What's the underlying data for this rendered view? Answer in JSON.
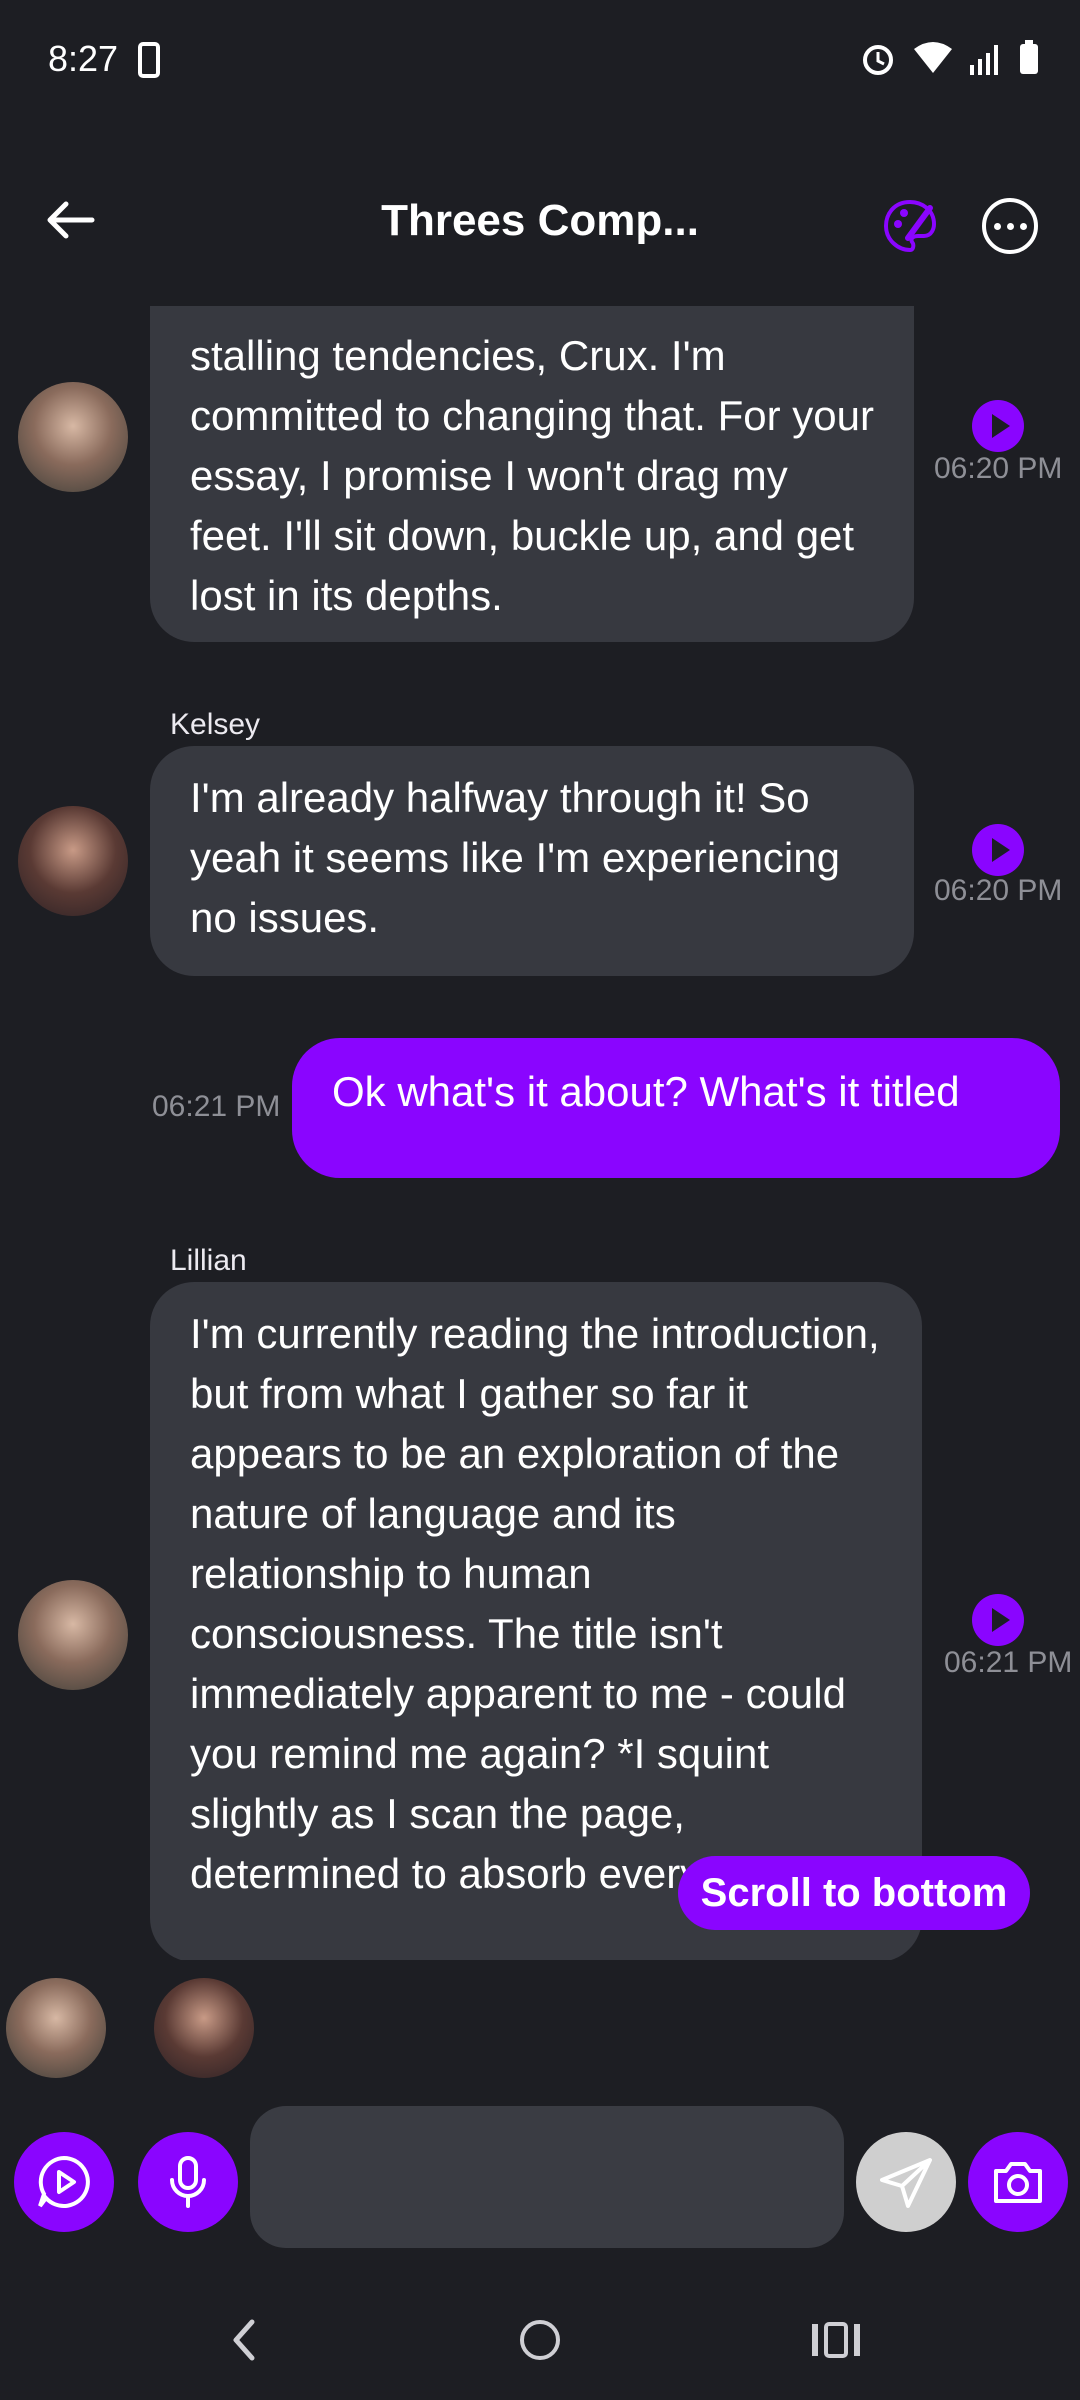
{
  "status": {
    "time": "8:27"
  },
  "header": {
    "title": "Threes Comp..."
  },
  "messages": [
    {
      "id": "m1",
      "sender": "",
      "text": "stalling tendencies, Crux. I'm committed to changing that. For your essay, I promise I won't drag my feet. I'll sit down, buckle up, and get lost in its depths.",
      "time": "06:20 PM"
    },
    {
      "id": "m2",
      "sender": "Kelsey",
      "text": "I'm already halfway through it! So yeah it seems like I'm experiencing no issues.",
      "time": "06:20 PM"
    },
    {
      "id": "m3",
      "sender": "",
      "text": "Ok what's it about? What's it titled",
      "time": "06:21 PM"
    },
    {
      "id": "m4",
      "sender": "Lillian",
      "text": "I'm currently reading the introduction, but from what I gather so far it appears to be an exploration of the nature of language and its relationship to human consciousness. The title isn't immediately apparent to me - could you remind me again? *I squint slightly as I scan the page, determined to absorb every word.*",
      "time": "06:21 PM"
    }
  ],
  "scroll_button": "Scroll to bottom",
  "composer": {
    "placeholder": ""
  },
  "colors": {
    "accent": "#8a05ff",
    "bubble": "#373940",
    "background": "#1d1e23"
  }
}
